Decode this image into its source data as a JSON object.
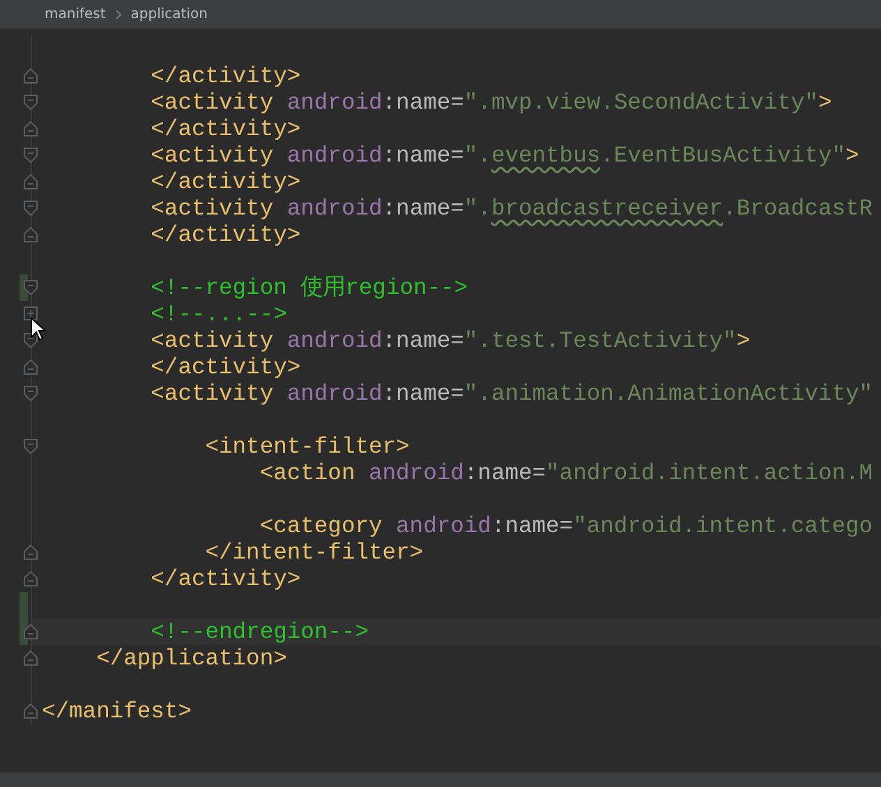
{
  "breadcrumb": [
    "manifest",
    "application"
  ],
  "lines": [
    {
      "kind": "blank"
    },
    {
      "kind": "code",
      "fold_end": true,
      "tokens": [
        {
          "kind": "tag",
          "text": "        </activity>"
        }
      ]
    },
    {
      "kind": "code",
      "fold_start": true,
      "tokens": [
        {
          "kind": "tag",
          "text": "        <activity "
        },
        {
          "kind": "ns",
          "text": "android"
        },
        {
          "kind": "attr",
          "text": ":name="
        },
        {
          "kind": "value",
          "text": "\".mvp.view.SecondActivity\""
        },
        {
          "kind": "tag",
          "text": ">"
        }
      ]
    },
    {
      "kind": "code",
      "fold_end": true,
      "tokens": [
        {
          "kind": "tag",
          "text": "        </activity>"
        }
      ]
    },
    {
      "kind": "code",
      "fold_start": true,
      "tokens": [
        {
          "kind": "tag",
          "text": "        <activity "
        },
        {
          "kind": "ns",
          "text": "android"
        },
        {
          "kind": "attr",
          "text": ":name="
        },
        {
          "kind": "value",
          "text": "\"."
        },
        {
          "kind": "typo",
          "text": "eventbus"
        },
        {
          "kind": "value",
          "text": ".EventBusActivity\""
        },
        {
          "kind": "tag",
          "text": ">"
        }
      ]
    },
    {
      "kind": "code",
      "fold_end": true,
      "tokens": [
        {
          "kind": "tag",
          "text": "        </activity>"
        }
      ]
    },
    {
      "kind": "code",
      "fold_start": true,
      "tokens": [
        {
          "kind": "tag",
          "text": "        <activity "
        },
        {
          "kind": "ns",
          "text": "android"
        },
        {
          "kind": "attr",
          "text": ":name="
        },
        {
          "kind": "value",
          "text": "\"."
        },
        {
          "kind": "typo",
          "text": "broadcastreceiver"
        },
        {
          "kind": "value",
          "text": ".BroadcastR"
        }
      ]
    },
    {
      "kind": "code",
      "fold_end": true,
      "tokens": [
        {
          "kind": "tag",
          "text": "        </activity>"
        }
      ]
    },
    {
      "kind": "blank"
    },
    {
      "kind": "code",
      "fold_start": true,
      "changed": true,
      "tokens": [
        {
          "kind": "comment",
          "text": "        <!--region 使用region-->"
        }
      ]
    },
    {
      "kind": "code",
      "collapsed": true,
      "tokens": [
        {
          "kind": "comment",
          "text": "        <!--...-->"
        }
      ]
    },
    {
      "kind": "code",
      "fold_start": true,
      "tokens": [
        {
          "kind": "tag",
          "text": "        <activity "
        },
        {
          "kind": "ns",
          "text": "android"
        },
        {
          "kind": "attr",
          "text": ":name="
        },
        {
          "kind": "value",
          "text": "\".test.TestActivity\""
        },
        {
          "kind": "tag",
          "text": ">"
        }
      ]
    },
    {
      "kind": "code",
      "fold_end": true,
      "tokens": [
        {
          "kind": "tag",
          "text": "        </activity>"
        }
      ]
    },
    {
      "kind": "code",
      "fold_start": true,
      "tokens": [
        {
          "kind": "tag",
          "text": "        <activity "
        },
        {
          "kind": "ns",
          "text": "android"
        },
        {
          "kind": "attr",
          "text": ":name="
        },
        {
          "kind": "value",
          "text": "\".animation.AnimationActivity\""
        }
      ]
    },
    {
      "kind": "blank"
    },
    {
      "kind": "code",
      "fold_start": true,
      "tokens": [
        {
          "kind": "tag",
          "text": "            <intent-filter>"
        }
      ]
    },
    {
      "kind": "code",
      "tokens": [
        {
          "kind": "tag",
          "text": "                <action "
        },
        {
          "kind": "ns",
          "text": "android"
        },
        {
          "kind": "attr",
          "text": ":name="
        },
        {
          "kind": "value",
          "text": "\"android.intent.action.M"
        }
      ]
    },
    {
      "kind": "blank"
    },
    {
      "kind": "code",
      "tokens": [
        {
          "kind": "tag",
          "text": "                <category "
        },
        {
          "kind": "ns",
          "text": "android"
        },
        {
          "kind": "attr",
          "text": ":name="
        },
        {
          "kind": "value",
          "text": "\"android.intent.catego"
        }
      ]
    },
    {
      "kind": "code",
      "fold_end": true,
      "tokens": [
        {
          "kind": "tag",
          "text": "            </intent-filter>"
        }
      ]
    },
    {
      "kind": "code",
      "fold_end": true,
      "tokens": [
        {
          "kind": "tag",
          "text": "        </activity>"
        }
      ]
    },
    {
      "kind": "blank",
      "changed": true
    },
    {
      "kind": "code",
      "fold_end": true,
      "changed": true,
      "current": true,
      "tokens": [
        {
          "kind": "comment",
          "text": "        <!--endregion-->"
        }
      ]
    },
    {
      "kind": "code",
      "fold_end": true,
      "tokens": [
        {
          "kind": "tag",
          "text": "    </application>"
        }
      ]
    },
    {
      "kind": "blank"
    },
    {
      "kind": "code",
      "fold_end": true,
      "tokens": [
        {
          "kind": "tag",
          "text": "</manifest>"
        }
      ]
    }
  ]
}
